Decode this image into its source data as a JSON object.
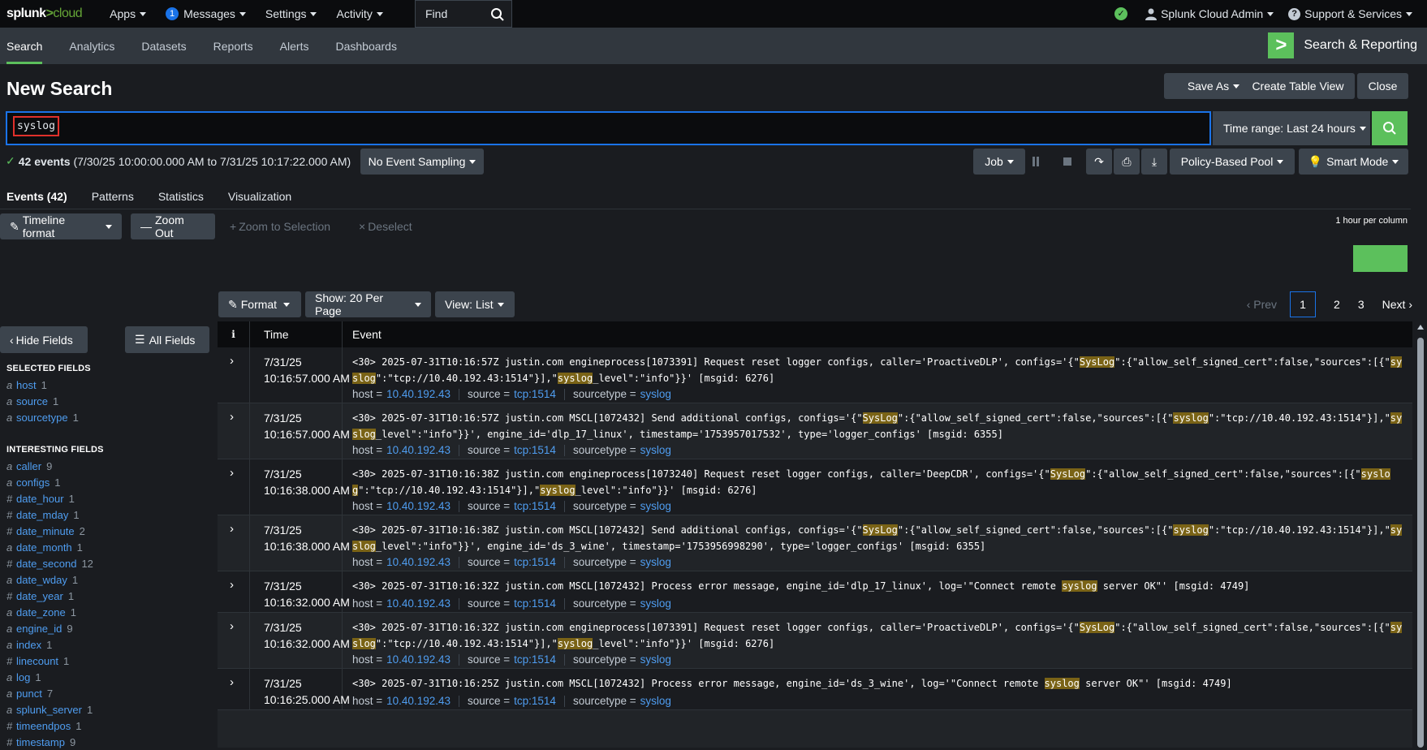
{
  "topbar": {
    "logo_main": "splunk",
    "logo_gt": ">",
    "logo_sub": "cloud",
    "menu": [
      {
        "label": "Apps"
      },
      {
        "label": "Messages",
        "badge": "1"
      },
      {
        "label": "Settings"
      },
      {
        "label": "Activity"
      }
    ],
    "find_label": "Find",
    "user": "Splunk Cloud Admin",
    "support": "Support & Services"
  },
  "appbar": {
    "tabs": [
      "Search",
      "Analytics",
      "Datasets",
      "Reports",
      "Alerts",
      "Dashboards"
    ],
    "active_tab": "Search",
    "app_name": "Search & Reporting"
  },
  "page": {
    "title": "New Search",
    "save_as": "Save As",
    "create_table_view": "Create Table View",
    "close": "Close"
  },
  "search": {
    "query": "syslog",
    "time_range": "Time range: Last 24 hours"
  },
  "results": {
    "summary_count": "42 events",
    "summary_range": "(7/30/25 10:00:00.000 AM to 7/31/25 10:17:22.000 AM)",
    "sampling": "No Event Sampling",
    "job": "Job",
    "pool": "Policy-Based Pool",
    "mode": "Smart Mode"
  },
  "subtabs": [
    "Events (42)",
    "Patterns",
    "Statistics",
    "Visualization"
  ],
  "timeline": {
    "format": "Timeline format",
    "zoom_out": "Zoom Out",
    "zoom_selection": "Zoom to Selection",
    "deselect": "Deselect",
    "scale": "1 hour per column"
  },
  "table_controls": {
    "format": "Format",
    "show": "Show: 20 Per Page",
    "view": "View: List",
    "prev": "Prev",
    "pages": [
      "1",
      "2",
      "3"
    ],
    "current_page": "1",
    "next": "Next"
  },
  "sidebar": {
    "hide_fields": "Hide Fields",
    "all_fields": "All Fields",
    "selected_title": "SELECTED FIELDS",
    "selected": [
      {
        "type": "a",
        "name": "host",
        "count": "1"
      },
      {
        "type": "a",
        "name": "source",
        "count": "1"
      },
      {
        "type": "a",
        "name": "sourcetype",
        "count": "1"
      }
    ],
    "interesting_title": "INTERESTING FIELDS",
    "interesting": [
      {
        "type": "a",
        "name": "caller",
        "count": "9"
      },
      {
        "type": "a",
        "name": "configs",
        "count": "1"
      },
      {
        "type": "#",
        "name": "date_hour",
        "count": "1"
      },
      {
        "type": "#",
        "name": "date_mday",
        "count": "1"
      },
      {
        "type": "#",
        "name": "date_minute",
        "count": "2"
      },
      {
        "type": "a",
        "name": "date_month",
        "count": "1"
      },
      {
        "type": "#",
        "name": "date_second",
        "count": "12"
      },
      {
        "type": "a",
        "name": "date_wday",
        "count": "1"
      },
      {
        "type": "#",
        "name": "date_year",
        "count": "1"
      },
      {
        "type": "a",
        "name": "date_zone",
        "count": "1"
      },
      {
        "type": "a",
        "name": "engine_id",
        "count": "9"
      },
      {
        "type": "a",
        "name": "index",
        "count": "1"
      },
      {
        "type": "#",
        "name": "linecount",
        "count": "1"
      },
      {
        "type": "a",
        "name": "log",
        "count": "1"
      },
      {
        "type": "a",
        "name": "punct",
        "count": "7"
      },
      {
        "type": "a",
        "name": "splunk_server",
        "count": "1"
      },
      {
        "type": "#",
        "name": "timeendpos",
        "count": "1"
      },
      {
        "type": "#",
        "name": "timestamp",
        "count": "9"
      }
    ]
  },
  "events_table": {
    "col_info": "i",
    "col_time": "Time",
    "col_event": "Event",
    "meta_labels": {
      "host": "host =",
      "source": "source =",
      "sourcetype": "sourcetype ="
    },
    "meta_values": {
      "host": "10.40.192.43",
      "source": "tcp:1514",
      "sourcetype": "syslog"
    },
    "rows": [
      {
        "date": "7/31/25",
        "time": "10:16:57.000 AM",
        "raw": [
          [
            "<30> 2025-07-31T10:16:57Z justin.com engineprocess[1073391] Request reset logger configs, caller='ProactiveDLP', configs='{\"",
            0
          ],
          [
            "SysLog",
            1
          ],
          [
            "\":{\"allow_self_signed_cert\":false,\"sources\":[{\"",
            0
          ],
          [
            "syslog",
            1
          ],
          [
            "\":\"tcp://10.40.192.43:1514\"}],\"",
            0
          ],
          [
            "syslog",
            1
          ],
          [
            "_level\":\"info\"}}' [msgid: 6276]",
            0
          ]
        ]
      },
      {
        "date": "7/31/25",
        "time": "10:16:57.000 AM",
        "raw": [
          [
            "<30> 2025-07-31T10:16:57Z justin.com MSCL[1072432] Send additional configs, configs='{\"",
            0
          ],
          [
            "SysLog",
            1
          ],
          [
            "\":{\"allow_self_signed_cert\":false,\"sources\":[{\"",
            0
          ],
          [
            "syslog",
            1
          ],
          [
            "\":\"tcp://10.40.192.43:1514\"}],\"",
            0
          ],
          [
            "syslog",
            1
          ],
          [
            "_level\":\"info\"}}', engine_id='dlp_17_linux', timestamp='1753957017532', type='logger_configs' [msgid: 6355]",
            0
          ]
        ]
      },
      {
        "date": "7/31/25",
        "time": "10:16:38.000 AM",
        "raw": [
          [
            "<30> 2025-07-31T10:16:38Z justin.com engineprocess[1073240] Request reset logger configs, caller='DeepCDR', configs='{\"",
            0
          ],
          [
            "SysLog",
            1
          ],
          [
            "\":{\"allow_self_signed_cert\":false,\"sources\":[{\"",
            0
          ],
          [
            "syslog",
            1
          ],
          [
            "\":\"tcp://10.40.192.43:1514\"}],\"",
            0
          ],
          [
            "syslog",
            1
          ],
          [
            "_level\":\"info\"}}' [msgid: 6276]",
            0
          ]
        ]
      },
      {
        "date": "7/31/25",
        "time": "10:16:38.000 AM",
        "raw": [
          [
            "<30> 2025-07-31T10:16:38Z justin.com MSCL[1072432] Send additional configs, configs='{\"",
            0
          ],
          [
            "SysLog",
            1
          ],
          [
            "\":{\"allow_self_signed_cert\":false,\"sources\":[{\"",
            0
          ],
          [
            "syslog",
            1
          ],
          [
            "\":\"tcp://10.40.192.43:1514\"}],\"",
            0
          ],
          [
            "syslog",
            1
          ],
          [
            "_level\":\"info\"}}', engine_id='ds_3_wine', timestamp='1753956998290', type='logger_configs' [msgid: 6355]",
            0
          ]
        ]
      },
      {
        "date": "7/31/25",
        "time": "10:16:32.000 AM",
        "raw": [
          [
            "<30> 2025-07-31T10:16:32Z justin.com MSCL[1072432] Process error message, engine_id='dlp_17_linux', log='\"Connect remote ",
            0
          ],
          [
            "syslog",
            1
          ],
          [
            " server OK\"' [msgid: 4749]",
            0
          ]
        ]
      },
      {
        "date": "7/31/25",
        "time": "10:16:32.000 AM",
        "raw": [
          [
            "<30> 2025-07-31T10:16:32Z justin.com engineprocess[1073391] Request reset logger configs, caller='ProactiveDLP', configs='{\"",
            0
          ],
          [
            "SysLog",
            1
          ],
          [
            "\":{\"allow_self_signed_cert\":false,\"sources\":[{\"",
            0
          ],
          [
            "syslog",
            1
          ],
          [
            "\":\"tcp://10.40.192.43:1514\"}],\"",
            0
          ],
          [
            "syslog",
            1
          ],
          [
            "_level\":\"info\"}}' [msgid: 6276]",
            0
          ]
        ]
      },
      {
        "date": "7/31/25",
        "time": "10:16:25.000 AM",
        "raw": [
          [
            "<30> 2025-07-31T10:16:25Z justin.com MSCL[1072432] Process error message, engine_id='ds_3_wine', log='\"Connect remote ",
            0
          ],
          [
            "syslog",
            1
          ],
          [
            " server OK\"' [msgid: 4749]",
            0
          ]
        ]
      }
    ]
  }
}
